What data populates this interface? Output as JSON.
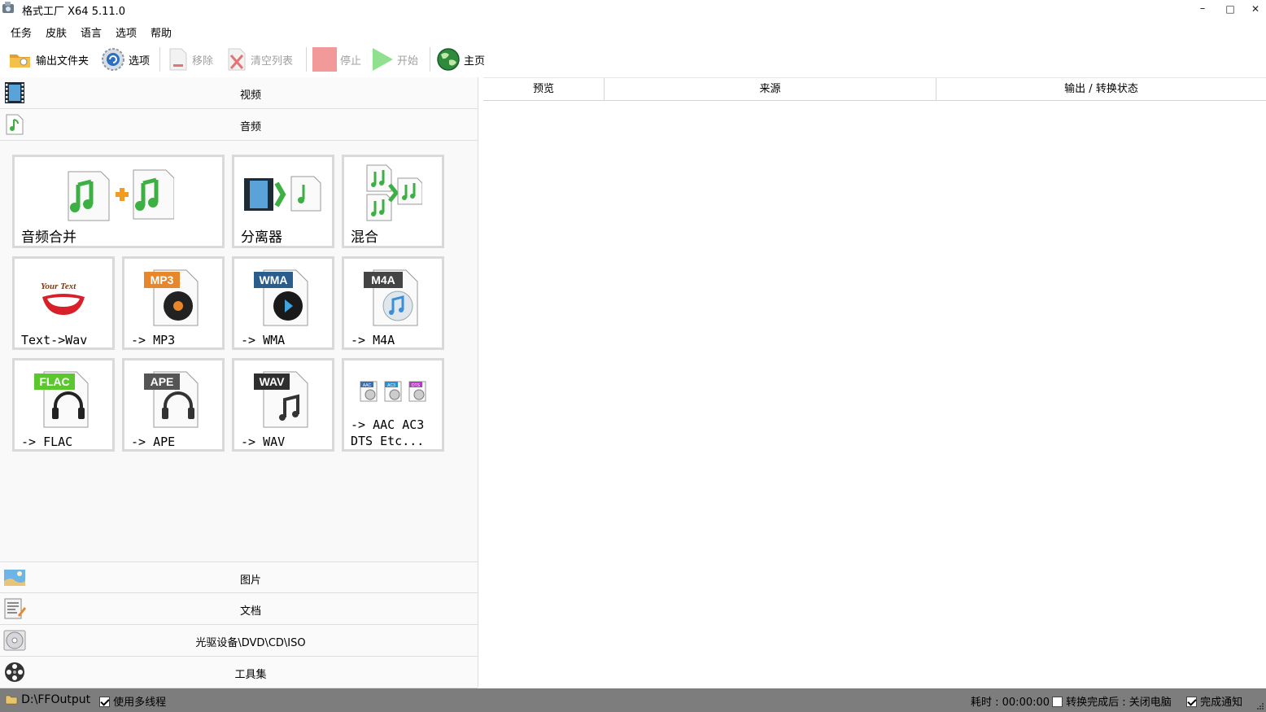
{
  "window": {
    "title": "格式工厂 X64 5.11.0",
    "minimize": "–",
    "maximize": "□",
    "close": "✕"
  },
  "menu": [
    "任务",
    "皮肤",
    "语言",
    "选项",
    "帮助"
  ],
  "toolbar": {
    "output_folder": "输出文件夹",
    "options": "选项",
    "remove": "移除",
    "clear_list": "清空列表",
    "stop": "停止",
    "start": "开始",
    "home": "主页"
  },
  "categories": {
    "video": "视频",
    "audio": "音频",
    "picture": "图片",
    "document": "文档",
    "optical": "光驱设备\\DVD\\CD\\ISO",
    "tools": "工具集"
  },
  "audio_tiles": {
    "merge": "音频合并",
    "splitter": "分离器",
    "mix": "混合",
    "text_wav": "Text->Wav",
    "mp3": "-> MP3",
    "wma": "-> WMA",
    "m4a": "-> M4A",
    "flac": "-> FLAC",
    "ape": "-> APE",
    "wav": "-> WAV",
    "aac": "-> AAC AC3\nDTS Etc..."
  },
  "badges": {
    "mp3": "MP3",
    "wma": "WMA",
    "m4a": "M4A",
    "flac": "FLAC",
    "ape": "APE",
    "wav": "WAV",
    "your_text": "Your Text",
    "aac": "AAC",
    "ac3": "AC3",
    "dts": "DTS"
  },
  "table": {
    "columns": [
      "预览",
      "来源",
      "输出 / 转换状态"
    ]
  },
  "status": {
    "output_path": "D:\\FFOutput",
    "multithread": "使用多线程",
    "multithread_checked": true,
    "elapsed": "耗时 : 00:00:00",
    "after_convert": "转换完成后 : 关闭电脑",
    "after_convert_checked": false,
    "notify": "完成通知",
    "notify_checked": true
  },
  "colors": {
    "music_green": "#3cb043",
    "mp3_badge": "#e8862a",
    "wma_badge": "#2a5d8c",
    "m4a_badge": "#444444",
    "flac_badge": "#5cc62f",
    "ape_badge": "#555555",
    "wav_badge": "#2f2f2f",
    "statusbar": "#7d7d7d"
  }
}
